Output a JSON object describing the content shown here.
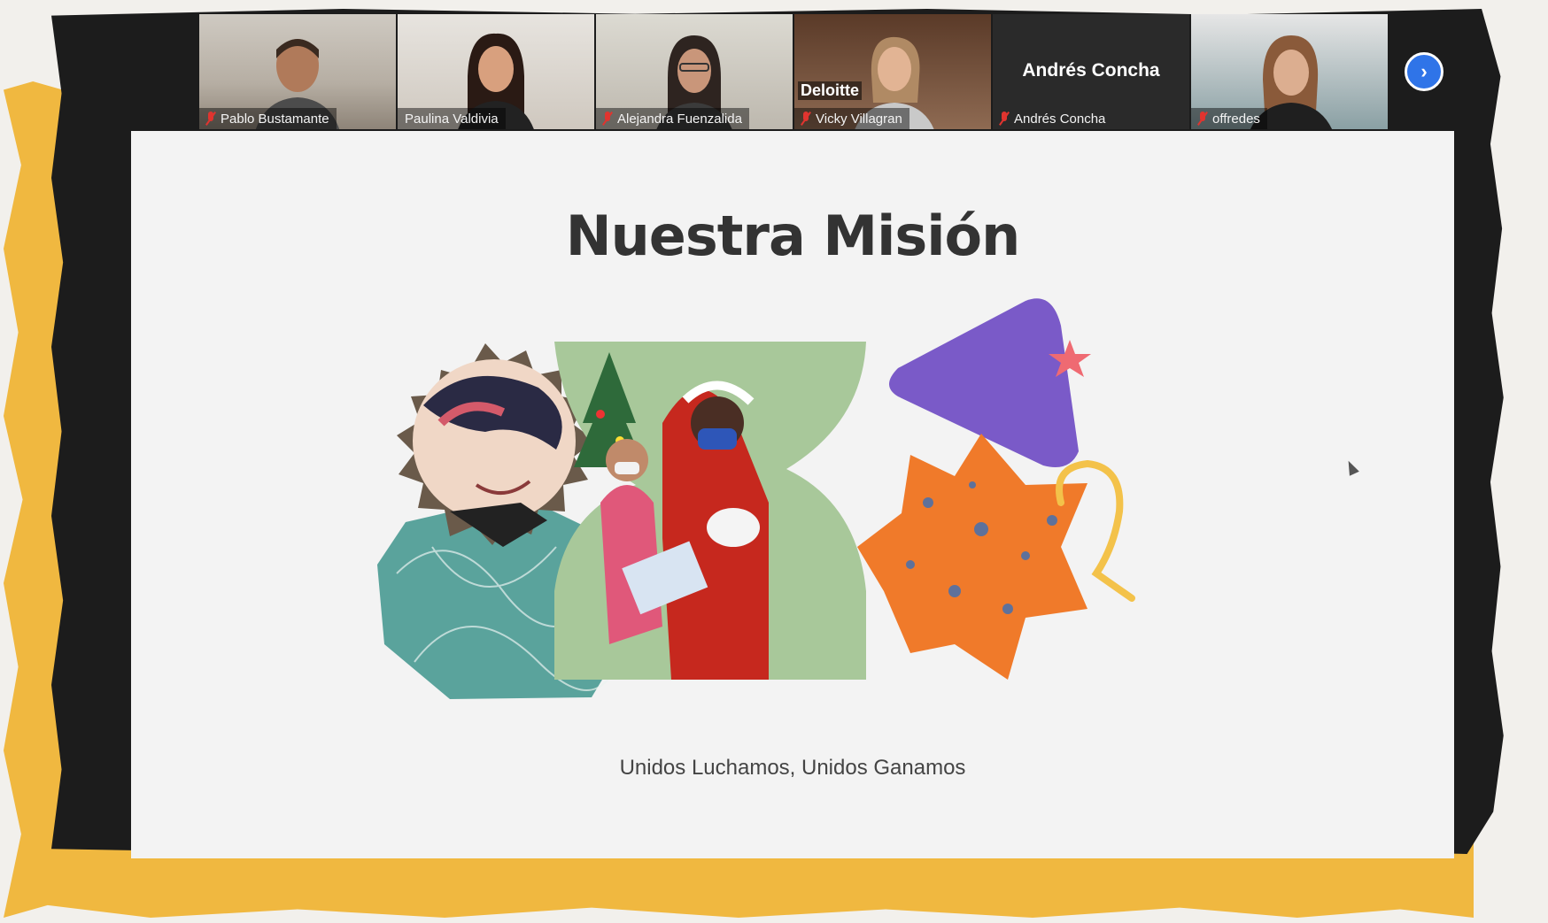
{
  "participants": [
    {
      "name": "Pablo Bustamante",
      "muted": true
    },
    {
      "name": "Paulina Valdivia",
      "muted": false
    },
    {
      "name": "Alejandra Fuenzalida",
      "muted": true
    },
    {
      "name": "Vicky Villagran",
      "muted": true,
      "overlay_text": "Deloitte"
    },
    {
      "name": "Andrés Concha",
      "muted": true,
      "camera_off": true
    },
    {
      "name": "offredes",
      "muted": true
    }
  ],
  "next_page_icon": "chevron-right-icon",
  "slide": {
    "title": "Nuestra Misión",
    "subtitle": "Unidos Luchamos, Unidos Ganamos"
  },
  "colors": {
    "window_bg": "#1c1c1c",
    "paper_yellow": "#f0b840",
    "slide_bg": "#f3f3f3",
    "accent_blue": "#2f74e8",
    "teal_shape": "#5aa39c",
    "purple_shape": "#7a5ac8",
    "orange_shape": "#f07a2a"
  }
}
